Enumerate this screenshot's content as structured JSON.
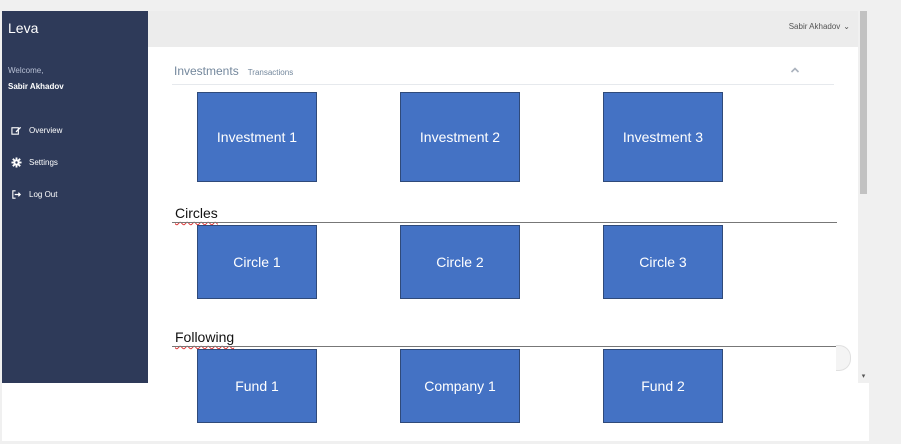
{
  "sidebar": {
    "brand": "Leva",
    "welcome": "Welcome,",
    "username": "Sabir Akhadov",
    "items": [
      {
        "label": "Overview",
        "icon": "edit-icon"
      },
      {
        "label": "Settings",
        "icon": "gear-icon"
      },
      {
        "label": "Log Out",
        "icon": "logout-icon"
      }
    ]
  },
  "header": {
    "user_menu": "Sabir Akhadov",
    "chevron": "⌄"
  },
  "panel": {
    "title": "Investments",
    "subtitle": "Transactions"
  },
  "sections": {
    "investments": [
      "Investment 1",
      "Investment 2",
      "Investment 3"
    ],
    "circles_label": "Circles",
    "circles": [
      "Circle 1",
      "Circle 2",
      "Circle 3"
    ],
    "following_label": "Following",
    "following": [
      "Fund 1",
      "Company 1",
      "Fund 2"
    ]
  },
  "colors": {
    "sidebar": "#2e3a59",
    "tile": "#4472c4",
    "topbar": "#ececec"
  }
}
